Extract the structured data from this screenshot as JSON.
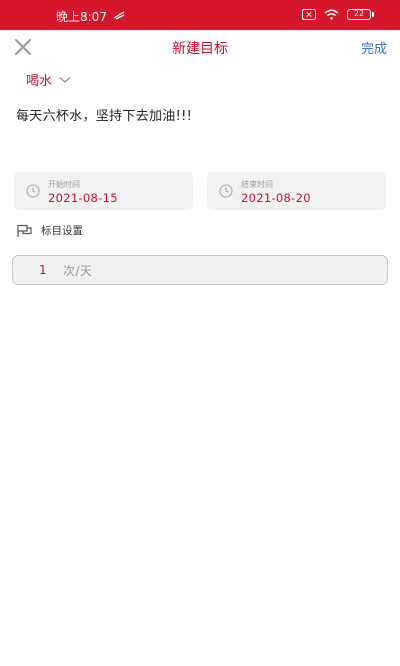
{
  "status_bar": {
    "time": "晚上8:07",
    "battery_level": "22"
  },
  "header": {
    "title": "新建目标",
    "done_label": "完成",
    "close_icon": "close-icon"
  },
  "category": {
    "selected": "喝水"
  },
  "goal": {
    "text": "每天六杯水，坚持下去加油!!!"
  },
  "dates": {
    "start": {
      "caption": "开始时间",
      "value": "2021-08-15"
    },
    "end": {
      "caption": "结束时间",
      "value": "2021-08-20"
    }
  },
  "goal_settings": {
    "label": "标目设置",
    "frequency_value": "1",
    "frequency_unit": "次/天"
  },
  "colors": {
    "brand_red": "#d6162b",
    "accent_text": "#c8102e",
    "link_blue": "#2f6fd6"
  }
}
